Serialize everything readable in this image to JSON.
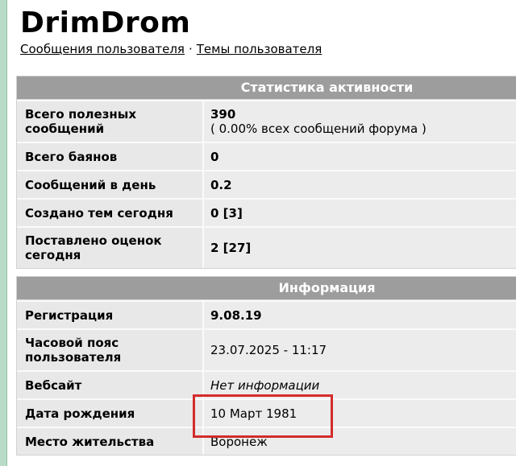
{
  "user": {
    "name": "DrimDrom",
    "links": [
      {
        "label": "Сообщения пользователя"
      },
      {
        "label": "Темы пользователя"
      }
    ],
    "separator": "·"
  },
  "activity": {
    "title": "Статистика активности",
    "rows": [
      {
        "label": "Всего полезных сообщений",
        "value": "390",
        "subvalue": "( 0.00% всех сообщений форума )"
      },
      {
        "label": "Всего баянов",
        "value": "0"
      },
      {
        "label": "Сообщений в день",
        "value": "0.2"
      },
      {
        "label": "Создано тем сегодня",
        "value": "0 [3]"
      },
      {
        "label": "Поставлено оценок сегодня",
        "value": "2 [27]"
      }
    ]
  },
  "info": {
    "title": "Информация",
    "rows": [
      {
        "label": "Регистрация",
        "value": "9.08.19"
      },
      {
        "label": "Часовой пояс пользователя",
        "value": "23.07.2025 - 11:17"
      },
      {
        "label": "Вебсайт",
        "value": "Нет информации"
      },
      {
        "label": "Дата рождения",
        "value": "10 Март 1981"
      },
      {
        "label": "Место жительства",
        "value": "Воронеж"
      }
    ]
  },
  "colors": {
    "panel_header": "#9d9d9d",
    "cell_bg": "#e8e8e8",
    "highlight": "#d42b2b",
    "left_bar": "#b9dcc8"
  }
}
